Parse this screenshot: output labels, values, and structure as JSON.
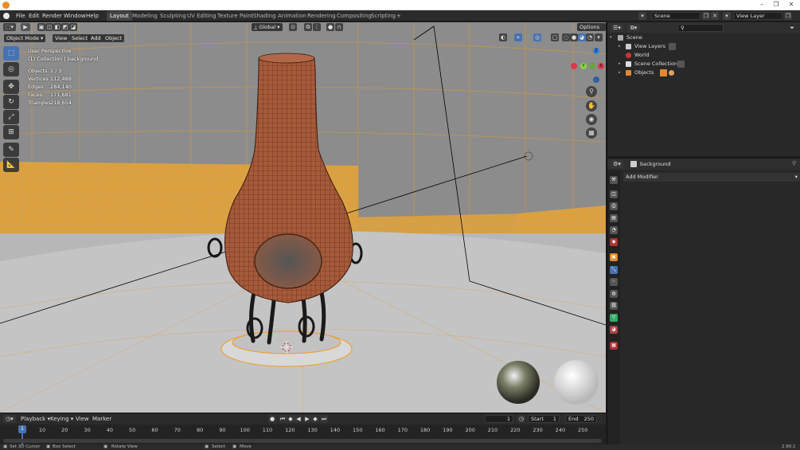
{
  "window": {
    "minimize": "–",
    "maximize": "❐",
    "close": "✕"
  },
  "menu": {
    "file": "File",
    "edit": "Edit",
    "render": "Render",
    "window": "Window",
    "help": "Help"
  },
  "workspaces": [
    "Layout",
    "Modeling",
    "Sculpting",
    "UV Editing",
    "Texture Paint",
    "Shading",
    "Animation",
    "Rendering",
    "Compositing",
    "Scripting"
  ],
  "workspace_add": "+",
  "scene_field": "Scene",
  "view_layer_field": "View Layer",
  "viewport_header": {
    "mode": "Object Mode",
    "view": "View",
    "select": "Select",
    "add": "Add",
    "object": "Object",
    "transform": "Global",
    "options": "Options"
  },
  "viewport_info": {
    "perspective": "User Perspective",
    "collection": "(1) Collection | background",
    "stats": [
      {
        "label": "Objects",
        "value": "1 / 3"
      },
      {
        "label": "Vertices",
        "value": "112,488"
      },
      {
        "label": "Edges",
        "value": "284,140"
      },
      {
        "label": "Faces",
        "value": "171,681"
      },
      {
        "label": "Triangles",
        "value": "218,654"
      }
    ]
  },
  "gizmo": {
    "x": "X",
    "y": "Y",
    "z": "Z"
  },
  "timeline": {
    "playback": "Playback",
    "keying": "Keying",
    "view": "View",
    "marker": "Marker",
    "current_frame": "1",
    "start_label": "Start",
    "start": "1",
    "end_label": "End",
    "end": "250",
    "ticks": [
      "10",
      "20",
      "30",
      "40",
      "50",
      "60",
      "70",
      "80",
      "90",
      "100",
      "110",
      "120",
      "130",
      "140",
      "150",
      "160",
      "170",
      "180",
      "190",
      "200",
      "210",
      "220",
      "230",
      "240",
      "250"
    ]
  },
  "outliner": {
    "rows": [
      {
        "label": "Scene"
      },
      {
        "label": "View Layers"
      },
      {
        "label": "World"
      },
      {
        "label": "Scene Collection"
      },
      {
        "label": "Objects"
      }
    ]
  },
  "properties": {
    "object_name": "background",
    "add_modifier": "Add Modifier"
  },
  "statusbar": {
    "left1": "Set 3D Cursor",
    "left2": "Box Select",
    "left3": "Rotate View",
    "mid1": "Select",
    "mid2": "Move",
    "version": "2.90.1"
  },
  "colors": {
    "accent": "#4772b3",
    "selection": "#f5a623",
    "brick": "#a65a3a"
  }
}
